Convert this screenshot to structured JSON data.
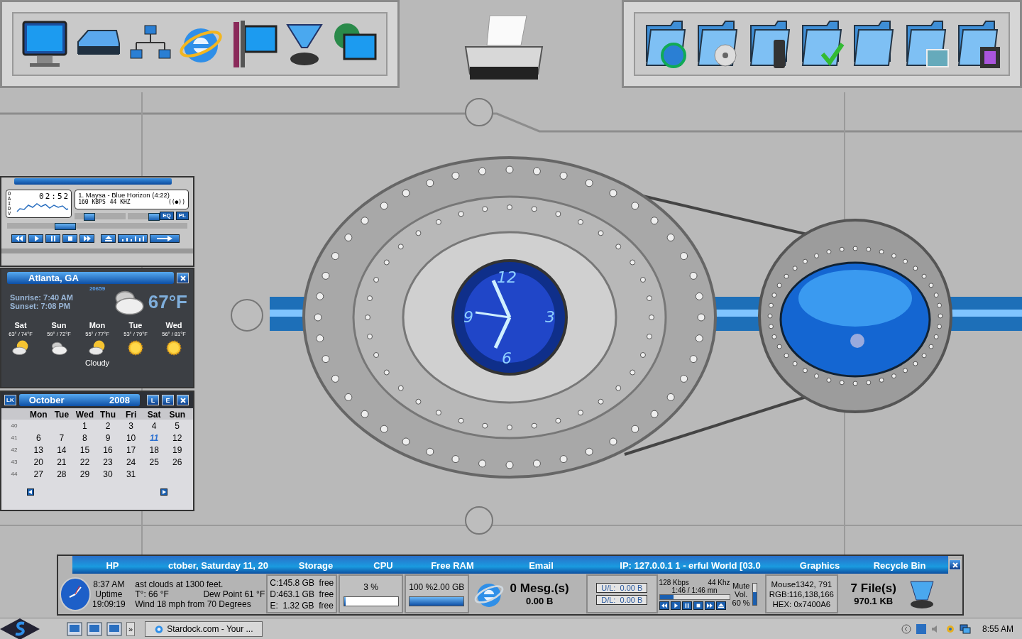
{
  "player": {
    "time": "02:52",
    "mode_letters": [
      "O",
      "A",
      "I",
      "D",
      "V"
    ],
    "track": "1. Maysa - Blue Horizon (4:22)",
    "bitrate": "160",
    "bitrate_unit": "KBPS",
    "rate": "44",
    "rate_unit": "KHZ",
    "stereo": "((●))",
    "buttons": [
      "EQ",
      "PL"
    ],
    "seek": {
      "level": 0.3
    },
    "volume": {
      "level": 0.22
    },
    "balance": {
      "level": 0.85
    }
  },
  "weather": {
    "city": "Atlanta, GA",
    "code": "20659",
    "sunrise": "Sunrise: 7:40 AM",
    "sunset": "Sunset: 7:08 PM",
    "temp": "67°F",
    "kind": "cloudy",
    "condition": "Cloudy",
    "forecast": [
      {
        "day": "Sat",
        "range": "63° / 74°F",
        "kind": "partly"
      },
      {
        "day": "Sun",
        "range": "59° / 72°F",
        "kind": "cloudy"
      },
      {
        "day": "Mon",
        "range": "55° / 77°F",
        "kind": "partly"
      },
      {
        "day": "Tue",
        "range": "53° / 79°F",
        "kind": "sunny"
      },
      {
        "day": "Wed",
        "range": "56° / 81°F",
        "kind": "sunny"
      }
    ]
  },
  "calendar": {
    "logo": "LK",
    "month": "October",
    "year": "2008",
    "buttons": [
      "L",
      "E"
    ],
    "weekdays": [
      "Mon",
      "Tue",
      "Wed",
      "Thu",
      "Fri",
      "Sat",
      "Sun"
    ],
    "weeks": [
      {
        "week": "40",
        "kind": "first",
        "days": [
          {
            "day": "1",
            "selected": false
          },
          {
            "day": "2",
            "selected": false
          },
          {
            "day": "3",
            "selected": false
          },
          {
            "day": "4",
            "selected": false
          },
          {
            "day": "5",
            "selected": false
          }
        ]
      },
      {
        "week": "41",
        "kind": "full",
        "days": [
          {
            "day": "6",
            "selected": false
          },
          {
            "day": "7",
            "selected": false
          },
          {
            "day": "8",
            "selected": false
          },
          {
            "day": "9",
            "selected": false
          },
          {
            "day": "10",
            "selected": false
          },
          {
            "day": "11",
            "selected": true
          },
          {
            "day": "12",
            "selected": false
          }
        ]
      },
      {
        "week": "42",
        "kind": "full",
        "days": [
          {
            "day": "13",
            "selected": false
          },
          {
            "day": "14",
            "selected": false
          },
          {
            "day": "15",
            "selected": false
          },
          {
            "day": "16",
            "selected": false
          },
          {
            "day": "17",
            "selected": false
          },
          {
            "day": "18",
            "selected": false
          },
          {
            "day": "19",
            "selected": false
          }
        ]
      },
      {
        "week": "43",
        "kind": "full",
        "days": [
          {
            "day": "20",
            "selected": false
          },
          {
            "day": "21",
            "selected": false
          },
          {
            "day": "22",
            "selected": false
          },
          {
            "day": "23",
            "selected": false
          },
          {
            "day": "24",
            "selected": false
          },
          {
            "day": "25",
            "selected": false
          },
          {
            "day": "26",
            "selected": false
          }
        ]
      },
      {
        "week": "44",
        "kind": "last",
        "days": [
          {
            "day": "27",
            "selected": false
          },
          {
            "day": "28",
            "selected": false
          },
          {
            "day": "29",
            "selected": false
          },
          {
            "day": "30",
            "selected": false
          },
          {
            "day": "31",
            "selected": false
          }
        ]
      }
    ]
  },
  "vault_clock": {
    "numerals": [
      "12",
      "3",
      "6",
      "9"
    ]
  },
  "bar": {
    "headers": [
      "HP",
      "ctober, Saturday 11, 20",
      "Storage",
      "CPU",
      "Free RAM",
      "Email",
      "IP: 127.0.0.1 1 - erful World [03.0",
      "Graphics",
      "Recycle Bin"
    ],
    "time": "8:37 AM",
    "uptime_label": "Uptime",
    "uptime": "19:09:19",
    "weather_lines": [
      "ast clouds at 1300 feet.",
      "T°: 66 °F",
      "Dew Point 61 °F",
      "Wind 18 mph from 70 Degrees"
    ],
    "storage": [
      "C:145.8 GB  free",
      "D:463.1 GB  free",
      "E:  1.32 GB  free"
    ],
    "cpu": {
      "reading": "3 %",
      "level": 0.03
    },
    "ram": {
      "reading": "100 %2.00 GB",
      "level": 1
    },
    "email": {
      "count": "0 Mesg.(s)",
      "size": "0.00 B"
    },
    "net": [
      "U/L:  0.00 B",
      "D/L:  0.00 B"
    ],
    "music": {
      "bitrate": "128 Kbps",
      "rate": "44 Khz",
      "time": "1:46 / 1:46 mn",
      "level": 0.2,
      "mute": "Mute",
      "vol_label": "Vol.",
      "vol": "60 %",
      "volume": {
        "level": 0.6
      }
    },
    "graphics": [
      "Mouse1342, 791",
      "RGB:116,138,166",
      "HEX: 0x7400A6"
    ],
    "recycle": {
      "files": "7 File(s)",
      "size": "970.1 KB"
    }
  },
  "taskbar": {
    "chevron": "»",
    "task": "Stardock.com - Your ...",
    "clock": "8:55 AM"
  }
}
